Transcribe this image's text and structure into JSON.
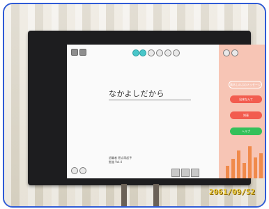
{
  "photo": {
    "title_text": "なかよしだから",
    "meta_line1": "退職者 原点再起予",
    "meta_line2": "勉強 Vol.4",
    "pill_top": "高木しのぶのメッセージ",
    "pill_red1": "出来なんて",
    "pill_red2": "知恵",
    "pill_green": "ヘルプ",
    "timestamp": "2061/09/52",
    "colors": {
      "frame": "#2f5bd6",
      "panel": "#f7c5b5",
      "red_button": "#f25c4f",
      "green_button": "#34c05a",
      "accent": "#49c6c9",
      "bars": "#f08a4b",
      "timestamp": "#f3d23e"
    }
  }
}
